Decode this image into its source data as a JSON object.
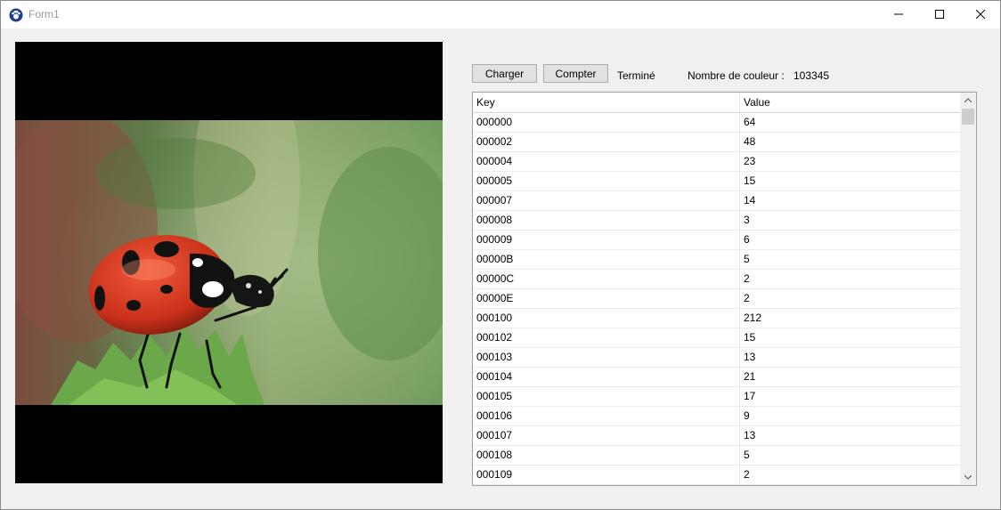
{
  "window": {
    "title": "Form1"
  },
  "toolbar": {
    "load_label": "Charger",
    "count_label": "Compter",
    "status_text": "Terminé",
    "color_count_caption": "Nombre de couleur :",
    "color_count_value": "103345"
  },
  "grid": {
    "columns": [
      "Key",
      "Value"
    ],
    "rows": [
      {
        "key": "000000",
        "value": "64"
      },
      {
        "key": "000002",
        "value": "48"
      },
      {
        "key": "000004",
        "value": "23"
      },
      {
        "key": "000005",
        "value": "15"
      },
      {
        "key": "000007",
        "value": "14"
      },
      {
        "key": "000008",
        "value": "3"
      },
      {
        "key": "000009",
        "value": "6"
      },
      {
        "key": "00000B",
        "value": "5"
      },
      {
        "key": "00000C",
        "value": "2"
      },
      {
        "key": "00000E",
        "value": "2"
      },
      {
        "key": "000100",
        "value": "212"
      },
      {
        "key": "000102",
        "value": "15"
      },
      {
        "key": "000103",
        "value": "13"
      },
      {
        "key": "000104",
        "value": "21"
      },
      {
        "key": "000105",
        "value": "17"
      },
      {
        "key": "000106",
        "value": "9"
      },
      {
        "key": "000107",
        "value": "13"
      },
      {
        "key": "000108",
        "value": "5"
      },
      {
        "key": "000109",
        "value": "2"
      }
    ]
  },
  "icons": {
    "app": "paw-icon",
    "minimize": "minimize-icon",
    "maximize": "maximize-icon",
    "close": "close-icon",
    "scroll_up": "chevron-up-icon",
    "scroll_down": "chevron-down-icon"
  },
  "picture": {
    "subject": "ladybug-photo"
  }
}
